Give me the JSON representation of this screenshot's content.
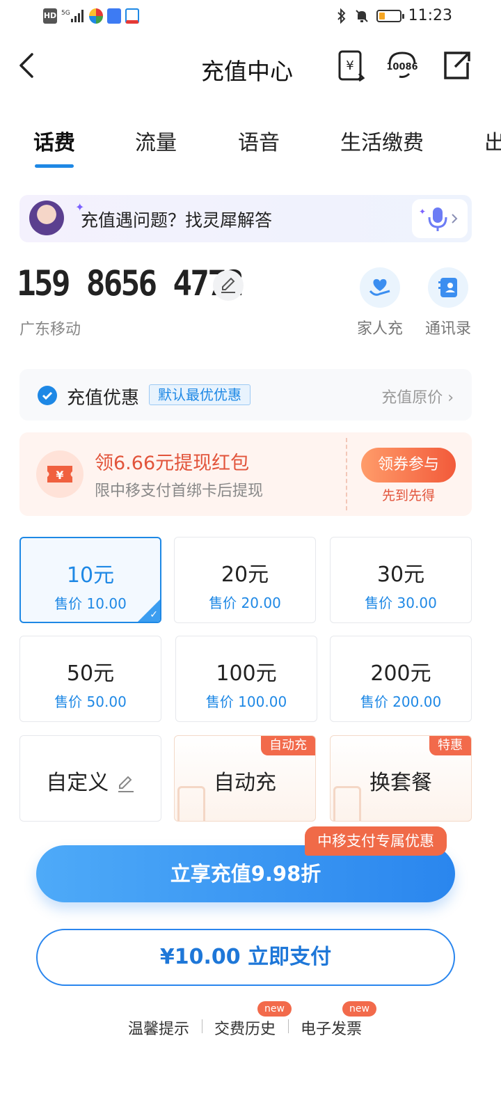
{
  "status_bar": {
    "time": "11:23",
    "left_icons": [
      "hd-icon",
      "signal-5g-icon",
      "app-icon-1",
      "app-icon-2",
      "app-icon-3"
    ],
    "right_icons": [
      "bluetooth-icon",
      "mute-icon",
      "battery-icon"
    ]
  },
  "header": {
    "title": "充值中心",
    "icons": [
      "bill-icon",
      "customer-service-10086-icon",
      "share-icon"
    ],
    "service_text": "10086"
  },
  "tabs": [
    {
      "label": "话费",
      "active": true
    },
    {
      "label": "流量"
    },
    {
      "label": "语音"
    },
    {
      "label": "生活缴费"
    },
    {
      "label": "出"
    }
  ],
  "ai_banner": {
    "text": "充值遇问题？找灵犀解答"
  },
  "account": {
    "phone": "159 8656 4772",
    "carrier": "广东移动",
    "quick_actions": [
      {
        "label": "家人充",
        "icon": "family-heart-icon"
      },
      {
        "label": "通讯录",
        "icon": "contacts-icon"
      }
    ]
  },
  "discount": {
    "title": "充值优惠",
    "badge": "默认最优优惠",
    "right": "充值原价 ›"
  },
  "coupon": {
    "title": "领6.66元提现红包",
    "subtitle": "限中移支付首绑卡后提现",
    "button": "领券参与",
    "button_sub": "先到先得"
  },
  "amounts": [
    {
      "value": "10元",
      "price": "售价 10.00",
      "selected": true
    },
    {
      "value": "20元",
      "price": "售价 20.00"
    },
    {
      "value": "30元",
      "price": "售价 30.00"
    },
    {
      "value": "50元",
      "price": "售价 50.00"
    },
    {
      "value": "100元",
      "price": "售价 100.00"
    },
    {
      "value": "200元",
      "price": "售价 200.00"
    }
  ],
  "special_options": [
    {
      "label": "自定义"
    },
    {
      "label": "自动充",
      "tag": "自动充"
    },
    {
      "label": "换套餐",
      "tag": "特惠"
    }
  ],
  "promo": {
    "button": "立享充值9.98折",
    "tag": "中移支付专属优惠"
  },
  "pay": {
    "button": "¥10.00  立即支付"
  },
  "footer": {
    "links": [
      {
        "label": "温馨提示"
      },
      {
        "label": "交费历史",
        "badge": "new"
      },
      {
        "label": "电子发票",
        "badge": "new"
      }
    ]
  },
  "colors": {
    "accent": "#1e88e5",
    "promo_orange": "#f26a4b"
  }
}
